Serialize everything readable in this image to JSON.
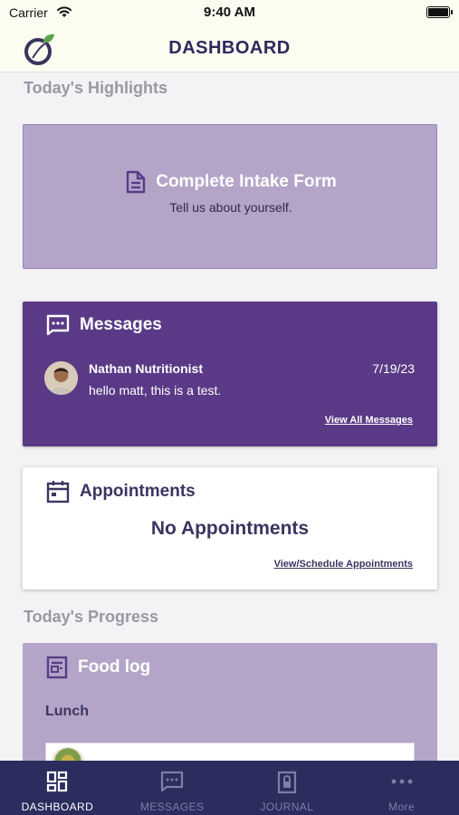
{
  "status_bar": {
    "carrier": "Carrier",
    "time": "9:40 AM"
  },
  "header": {
    "title": "DASHBOARD"
  },
  "highlights": {
    "section_title": "Today's Highlights",
    "intake": {
      "title": "Complete Intake Form",
      "subtitle": "Tell us about yourself."
    },
    "messages": {
      "title": "Messages",
      "latest": {
        "sender": "Nathan Nutritionist",
        "date": "7/19/23",
        "text": "hello matt, this is a test."
      },
      "view_all_label": "View All Messages"
    },
    "appointments": {
      "title": "Appointments",
      "empty_label": "No Appointments",
      "link_label": "View/Schedule Appointments"
    }
  },
  "progress": {
    "section_title": "Today's Progress",
    "food_log": {
      "title": "Food log",
      "meal": "Lunch",
      "item_label": ""
    }
  },
  "tab_bar": {
    "tabs": [
      {
        "label": "DASHBOARD",
        "icon": "dashboard-icon",
        "active": true
      },
      {
        "label": "MESSAGES",
        "icon": "chat-icon",
        "active": false
      },
      {
        "label": "JOURNAL",
        "icon": "lock-book-icon",
        "active": false
      },
      {
        "label": "More",
        "icon": "more-dots-icon",
        "active": false
      }
    ]
  },
  "colors": {
    "nav_background": "#fdfcf1",
    "brand_navy": "#2c2a5e",
    "highlight_lavender": "#b4a5c8",
    "messages_purple": "#5a3a86",
    "tab_bar": "#2a2d5e"
  }
}
